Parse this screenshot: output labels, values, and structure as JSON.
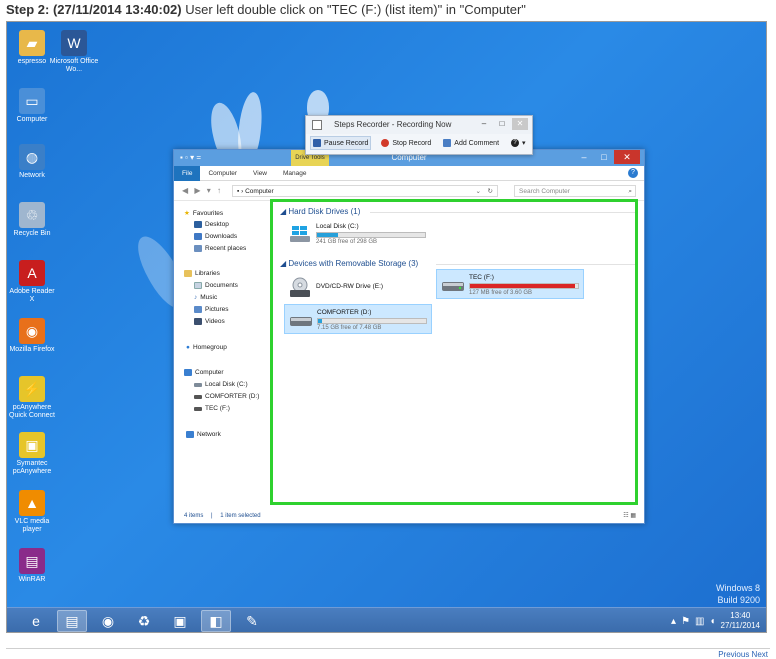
{
  "step": {
    "prefix": "Step 2: (27/11/2014 13:40:02)",
    "description": "User left double click on \"TEC (F:) (list item)\" in \"Computer\""
  },
  "desktop_icons": [
    {
      "label": "espresso",
      "icon": "folder-icon",
      "color": "#e8b84a"
    },
    {
      "label": "Microsoft Office Wo...",
      "icon": "word-icon",
      "color": "#2b5797"
    },
    {
      "label": "Computer",
      "icon": "computer-icon",
      "color": "#4a8fd8"
    },
    {
      "label": "Network",
      "icon": "network-icon",
      "color": "#3a7fc8"
    },
    {
      "label": "Recycle Bin",
      "icon": "recycle-bin-icon",
      "color": "#9fb6cf"
    },
    {
      "label": "Adobe Reader X",
      "icon": "adobe-reader-icon",
      "color": "#c81e1e"
    },
    {
      "label": "Mozilla Firefox",
      "icon": "firefox-icon",
      "color": "#e8701a"
    },
    {
      "label": "pcAnywhere Quick Connect",
      "icon": "quick-connect-icon",
      "color": "#e6c52a"
    },
    {
      "label": "Symantec pcAnywhere",
      "icon": "pcanywhere-icon",
      "color": "#e6c52a"
    },
    {
      "label": "VLC media player",
      "icon": "vlc-icon",
      "color": "#f08c00"
    },
    {
      "label": "WinRAR",
      "icon": "winrar-icon",
      "color": "#8a2b8a"
    }
  ],
  "recorder": {
    "title": "Steps Recorder - Recording Now",
    "pause": "Pause Record",
    "stop": "Stop Record",
    "add_comment": "Add Comment",
    "help": "?"
  },
  "explorer": {
    "title": "Computer",
    "drive_tools": "Drive Tools",
    "tabs": [
      "File",
      "Computer",
      "View",
      "Manage"
    ],
    "address": "Computer",
    "search_placeholder": "Search Computer",
    "nav": {
      "favourites": "Favourites",
      "fav_items": [
        "Desktop",
        "Downloads",
        "Recent places"
      ],
      "libraries": "Libraries",
      "lib_items": [
        "Documents",
        "Music",
        "Pictures",
        "Videos"
      ],
      "homegroup": "Homegroup",
      "computer": "Computer",
      "comp_items": [
        "Local Disk (C:)",
        "COMFORTER (D:)",
        "TEC (F:)"
      ],
      "network": "Network"
    },
    "groups": {
      "hard_disks": "Hard Disk Drives (1)",
      "removable": "Devices with Removable Storage (3)"
    },
    "drives": {
      "local_c": {
        "name": "Local Disk (C:)",
        "free": "241 GB free of 298 GB",
        "used_fraction": 0.19
      },
      "dvd": {
        "name": "DVD/CD-RW Drive (E:)",
        "badge": "DVD"
      },
      "tec": {
        "name": "TEC (F:)",
        "free": "127 MB free of 3.60 GB",
        "used_fraction": 0.97
      },
      "comforter": {
        "name": "COMFORTER (D:)",
        "free": "7.15 GB free of 7.48 GB",
        "used_fraction": 0.04
      }
    },
    "status": {
      "items": "4 items",
      "selected": "1 item selected"
    }
  },
  "watermark": {
    "line1": "Windows 8",
    "line2": "Build 9200"
  },
  "tray": {
    "time": "13:40",
    "date": "27/11/2014"
  },
  "footer": {
    "previous": "Previous",
    "next": "Next"
  }
}
